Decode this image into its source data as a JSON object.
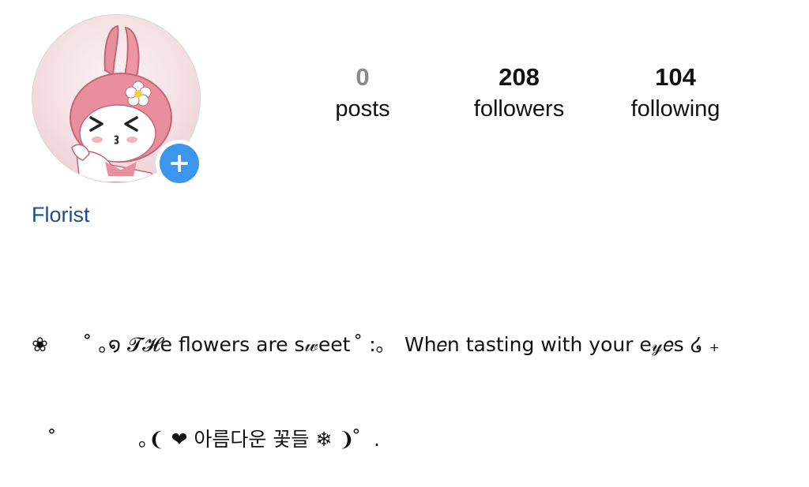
{
  "avatar": {
    "image": "My Melody character avatar",
    "add_icon": "plus-icon"
  },
  "stats": {
    "posts": {
      "count": "0",
      "label": "posts"
    },
    "followers": {
      "count": "208",
      "label": "followers"
    },
    "following": {
      "count": "104",
      "label": "following"
    }
  },
  "profile": {
    "name": "Florist"
  },
  "bio": {
    "line1": "❀       ̊ ｡໑ 𝓣𝓗e flowers are s𝓌eet  ̊ :｡   Wh𝑒n tasting with your e𝓎𝑒s ໒ ₊",
    "line2": "    ̊             ｡❨ ❤ 아름다운 꽃들 ❄ ❩ ̊  ."
  },
  "colors": {
    "accent_blue": "#3b96ee",
    "name_blue": "#1b4f86",
    "muted_count": "#8a8a8a",
    "text": "#111111"
  }
}
